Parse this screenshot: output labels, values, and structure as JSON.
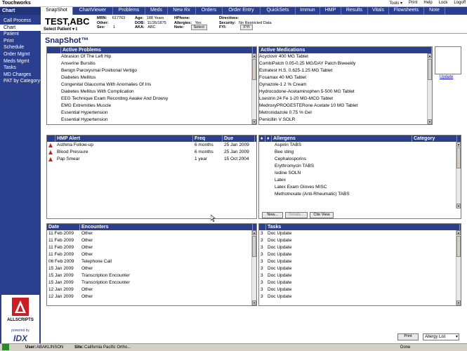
{
  "app": {
    "title": "Touchworks"
  },
  "top_menu": [
    "Tools ▾",
    "Print",
    "Help",
    "Lock",
    "Logoff"
  ],
  "sidebar": {
    "header": "Chart",
    "items": [
      {
        "label": "Call Process"
      },
      {
        "label": "Chart"
      },
      {
        "label": "Patient"
      },
      {
        "label": "Print"
      },
      {
        "label": "Schedule"
      },
      {
        "label": "Order Mgmt"
      },
      {
        "label": "Meds Mgmt"
      },
      {
        "label": "Tasks"
      },
      {
        "label": "MD Charges"
      },
      {
        "label": "PAT by Category"
      }
    ],
    "logo_text": "ALLSCRIPTS",
    "powered_by": "powered by",
    "idx": "IDX"
  },
  "tabs": [
    "SnapShot",
    "ChartViewer",
    "Problems",
    "Meds",
    "New Rx",
    "Orders",
    "Order Entry",
    "QuickSets",
    "Immun",
    "HMP",
    "Results",
    "Vitals",
    "Flowsheets",
    "Note"
  ],
  "patient": {
    "name": "TEST,ABC",
    "select_label": "Select Patient ▾",
    "mrn_label": "MRN:",
    "mrn": "617763",
    "other_label": "Other:",
    "other": "",
    "sex_label": "Sex:",
    "sex": "1",
    "age_label": "Age:",
    "age": "188 Years",
    "dob_label": "DOB:",
    "dob": "11/26/1875",
    "aka_label": "AKA:",
    "aka": "ABC",
    "hphone_label": "HPhone:",
    "hphone": "",
    "allergies_label": "Allergies:",
    "allergies": "Yes",
    "note_label": "Note:",
    "note_btn": "Select",
    "directives_label": "Directives:",
    "security_label": "Security:",
    "security": "No Restricted Data",
    "fyi_label": "FYI:",
    "fyi_btn": "FYI"
  },
  "page_title": "SnapShot™",
  "problems": {
    "header": "Active Problems",
    "rows": [
      "Abrasion Of The Left Hip",
      "Anserine Bursitis",
      "Benign Paroxysmal Positional Vertigo",
      "Diabetes Mellitus",
      "Congenital Glaucoma With Anomalies Of Iris",
      "Diabetes Mellitus With Complication",
      "EEG Technique Exam Recording Awake And Drowsy",
      "EMG Extremities Muscle",
      "Essential Hypertension",
      "Essential Hypertension"
    ]
  },
  "medications": {
    "header": "Active Medications",
    "rows": [
      "Acyclovir 400 MG Tablet",
      "CombiPatch 0.05-0.25 MG/DAY Patch Biweekly",
      "Estratest H.S. 0.625-1.25 MG Tablet",
      "Fosamax 40 MG Tablet",
      "Gynazole-1 2 % Cream",
      "Hydrocodone-Acetaminophen 5-500 MG Tablet",
      "Loestrin 24 Fe 1-20 MG-MCG Tablet",
      "MedroxyPROGESTERone Acetate 10 MG Tablet",
      "Metronidazole 0.75 % Gel",
      "Penicillin V SOLR"
    ]
  },
  "update_link": "Update",
  "hmp": {
    "headers": [
      "HMP Alert",
      "Freq",
      "Due"
    ],
    "rows": [
      {
        "alert": "Asthma Follow-up",
        "freq": "6 months",
        "due": "25 Jan 2009"
      },
      {
        "alert": "Blood Pressure",
        "freq": "6 months",
        "due": "25 Jan 2009"
      },
      {
        "alert": "Pap Smear",
        "freq": "1 year",
        "due": "15 Oct 2004"
      }
    ]
  },
  "allergens": {
    "headers": [
      "Allergens",
      "Category"
    ],
    "rows": [
      "Aspirin TABS",
      "Bee sting",
      "Cephalosporins",
      "Erythromycin TABS",
      "Iodine SOLN",
      "Latex",
      "Latex Exam Gloves MISC",
      "Methotrexate (Anti-Rheumatic) TABS"
    ],
    "buttons": [
      "New...",
      "Details...",
      "Cite View"
    ]
  },
  "encounters": {
    "headers": [
      "Date",
      "Encounters"
    ],
    "rows": [
      {
        "date": "11 Feb 2009",
        "type": "Other"
      },
      {
        "date": "11 Feb 2009",
        "type": "Other"
      },
      {
        "date": "11 Feb 2009",
        "type": "Other"
      },
      {
        "date": "11 Feb 2009",
        "type": "Other"
      },
      {
        "date": "06 Feb 2009",
        "type": "Telephone Call"
      },
      {
        "date": "15 Jan 2009",
        "type": "Other"
      },
      {
        "date": "15 Jan 2009",
        "type": "Transcription Encounter"
      },
      {
        "date": "15 Jan 2009",
        "type": "Transcription Encounter"
      },
      {
        "date": "12 Jan 2009",
        "type": "Other"
      },
      {
        "date": "12 Jan 2009",
        "type": "Other"
      }
    ]
  },
  "tasks": {
    "header": "Tasks",
    "rows": [
      "Doc Update",
      "Doc Update",
      "Doc Update",
      "Doc Update",
      "Doc Update",
      "Doc Update",
      "Doc Update",
      "Doc Update",
      "Doc Update",
      "Doc Update"
    ],
    "numbers": [
      "3",
      "3",
      "3",
      "3",
      "3",
      "3",
      "3",
      "3",
      "3",
      "3"
    ]
  },
  "bottom": {
    "print_btn": "Print",
    "allergy_select": "Allergy List"
  },
  "status": {
    "user_label": "User:",
    "user": "ABAKLINSON",
    "site_label": "Site:",
    "site": "California Pacific Ortho...",
    "done": "Done"
  }
}
